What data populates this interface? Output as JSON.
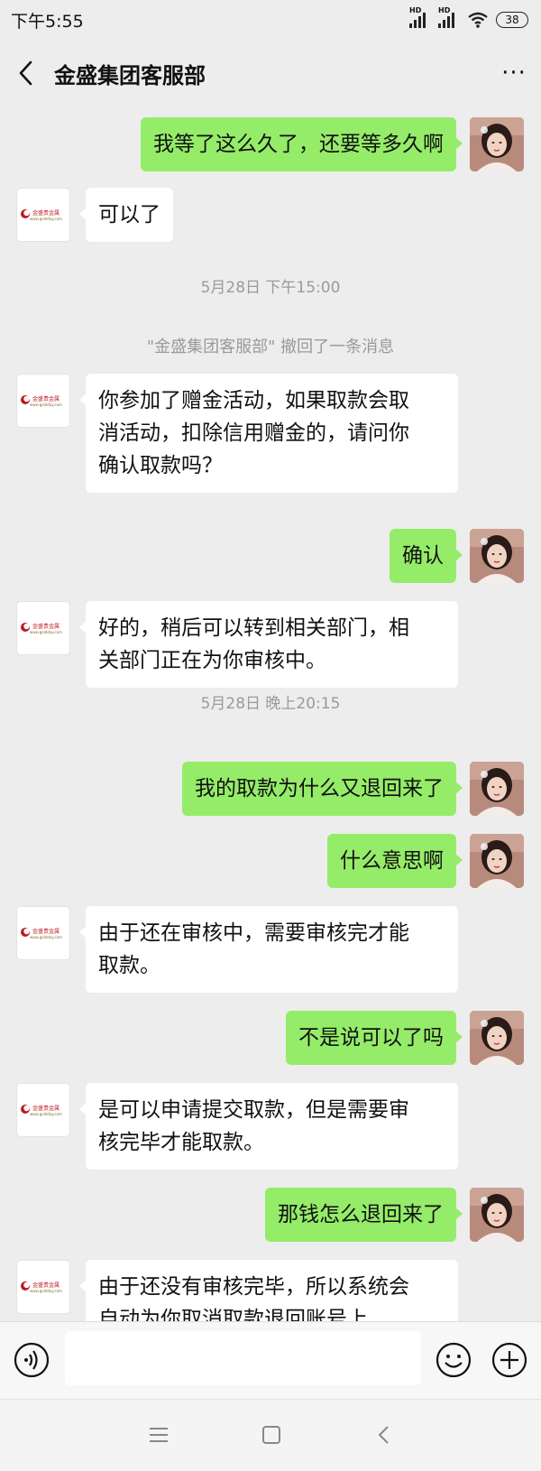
{
  "status_bar": {
    "time": "下午5:55",
    "signal_label_1": "HD",
    "signal_label_2": "HD",
    "battery": "38"
  },
  "header": {
    "title": "金盛集团客服部",
    "back_icon": "chevron-left-icon",
    "more_icon": "more-horizontal-icon",
    "more_label": "···"
  },
  "brand": {
    "logo_text": "金盛贵金属",
    "logo_url_text": "www.goldday.com",
    "logo_color": "#c0171f",
    "bubble_green": "#95ec69",
    "bubble_white": "#ffffff"
  },
  "messages": [
    {
      "side": "right",
      "text": "我等了这么久了，还要等多久啊"
    },
    {
      "side": "left",
      "text": "可以了"
    },
    {
      "type": "time",
      "text": "5月28日 下午15:00"
    },
    {
      "type": "notice",
      "text": "\"金盛集团客服部\" 撤回了一条消息"
    },
    {
      "side": "left",
      "lines": [
        "你参加了赠金活动，如果取款会取",
        "消活动，扣除信用赠金的，请问你",
        "确认取款吗？"
      ]
    },
    {
      "side": "right",
      "text": "确认"
    },
    {
      "side": "left",
      "lines": [
        "好的，稍后可以转到相关部门，相",
        "关部门正在为你审核中。"
      ]
    },
    {
      "type": "time",
      "text": "5月28日 晚上20:15"
    },
    {
      "side": "right",
      "text": "我的取款为什么又退回来了"
    },
    {
      "side": "right",
      "text": "什么意思啊"
    },
    {
      "side": "left",
      "lines": [
        "由于还在审核中，需要审核完才能",
        "取款。"
      ]
    },
    {
      "side": "right",
      "text": "不是说可以了吗"
    },
    {
      "side": "left",
      "lines": [
        "是可以申请提交取款，但是需要审",
        "核完毕才能取款。"
      ]
    },
    {
      "side": "right",
      "text": "那钱怎么退回来了"
    },
    {
      "side": "left",
      "lines": [
        "由于还没有审核完毕，所以系统会",
        "自动为你取消取款退回账号上"
      ]
    }
  ],
  "input_bar": {
    "voice_icon": "voice-icon",
    "emoji_icon": "emoji-icon",
    "plus_icon": "plus-circle-icon",
    "input_value": ""
  },
  "nav_bar": {
    "menu_icon": "menu-icon",
    "home_icon": "home-square-icon",
    "back_icon": "back-chevron-icon"
  }
}
